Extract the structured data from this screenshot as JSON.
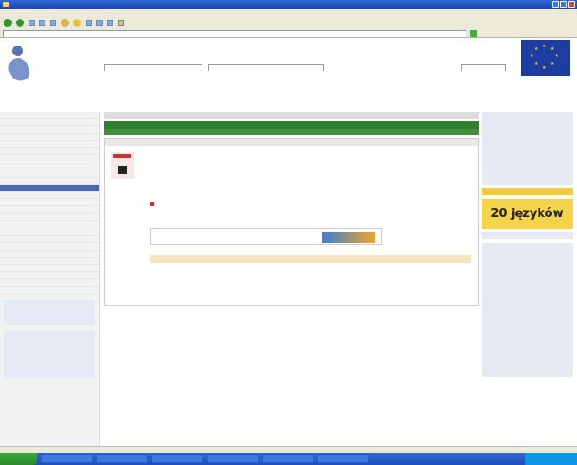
{
  "window": {
    "title": ""
  },
  "menu": [
    "",
    "",
    "",
    "",
    "",
    ""
  ],
  "page": {
    "language_banner": "20 języków"
  },
  "taskbar": {
    "start": ""
  },
  "colors": {
    "accent_green": "#2f7f2f",
    "nav_blue": "#4b68b8",
    "banner_yellow": "#f5d34a",
    "eu_blue": "#1d3da3"
  },
  "icons": [
    "ie-icon",
    "back-icon",
    "forward-icon",
    "refresh-icon",
    "home-icon",
    "search-icon",
    "favorites-icon",
    "eu-flag-icon",
    "agency-logo-icon",
    "pdf-icon"
  ]
}
